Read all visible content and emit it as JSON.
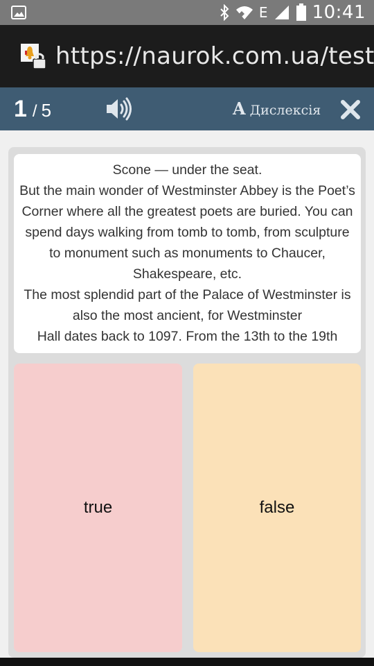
{
  "status_bar": {
    "time": "10:41",
    "network_letter": "E",
    "icons": [
      "image-icon",
      "bluetooth-icon",
      "wifi-icon",
      "signal-icon",
      "battery-icon"
    ]
  },
  "browser": {
    "url": "https://naurok.com.ua/test/testing/"
  },
  "quiz_header": {
    "current": "1",
    "separator": "/",
    "total": "5",
    "dyslexia_letter": "A",
    "dyslexia_label": "Дислексія",
    "background_color": "#3f5c73"
  },
  "question": {
    "text": "Scone — under the seat.\n   But the main wonder of Westminster Abbey is the Poet’s Corner where all the greatest poets are buried. You can spend days walking from tomb to tomb, from sculpture to monument such as monuments to Chaucer, Shakespeare, etc.\n   The most splendid part of the Palace of Westminster is also the most ancient, for Westminster\nHall dates back to 1097. From the 13th to the 19th"
  },
  "answers": [
    {
      "label": "true",
      "color": "#f6cdcd"
    },
    {
      "label": "false",
      "color": "#fbe1b8"
    }
  ]
}
